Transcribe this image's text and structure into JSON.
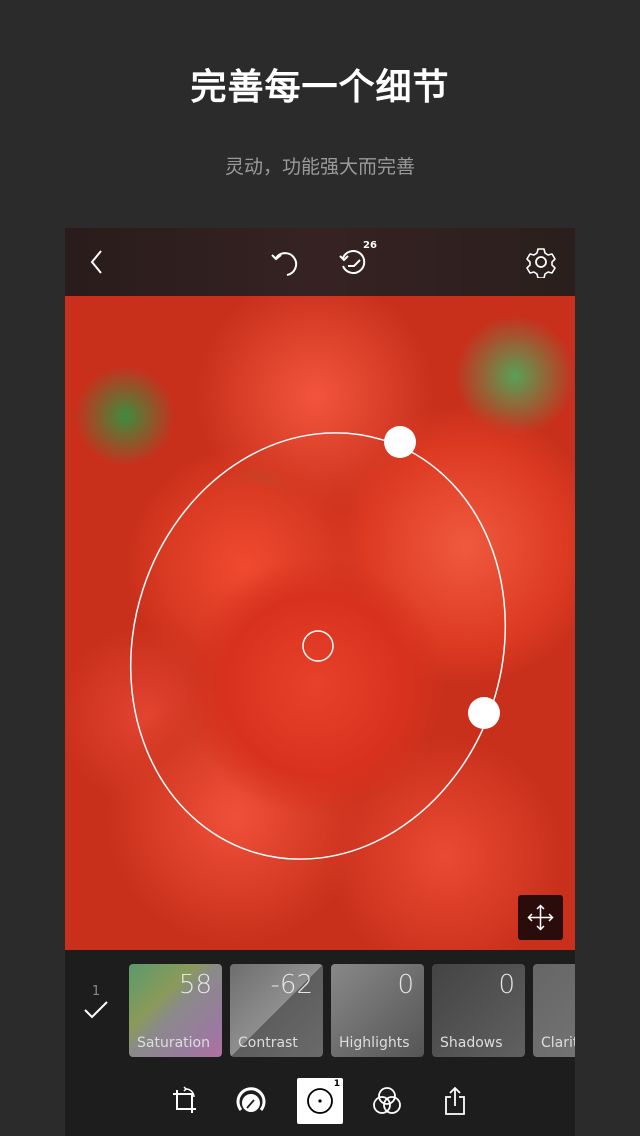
{
  "header": {
    "title": "完善每一个细节",
    "subtitle": "灵动，功能强大而完善"
  },
  "topbar": {
    "history_count": "26",
    "icons": [
      "back-icon",
      "undo-icon",
      "history-icon",
      "settings-icon"
    ]
  },
  "editor": {
    "apply_count": "1",
    "adjustments": [
      {
        "label": "Saturation",
        "value": "58"
      },
      {
        "label": "Contrast",
        "value": "-62"
      },
      {
        "label": "Highlights",
        "value": "0"
      },
      {
        "label": "Shadows",
        "value": "0"
      },
      {
        "label": "Clarity",
        "value": ""
      }
    ],
    "tools": [
      "crop-rotate-icon",
      "tune-dial-icon",
      "radial-filter-icon",
      "blend-icon",
      "share-icon"
    ],
    "active_tool_badge": "1"
  }
}
